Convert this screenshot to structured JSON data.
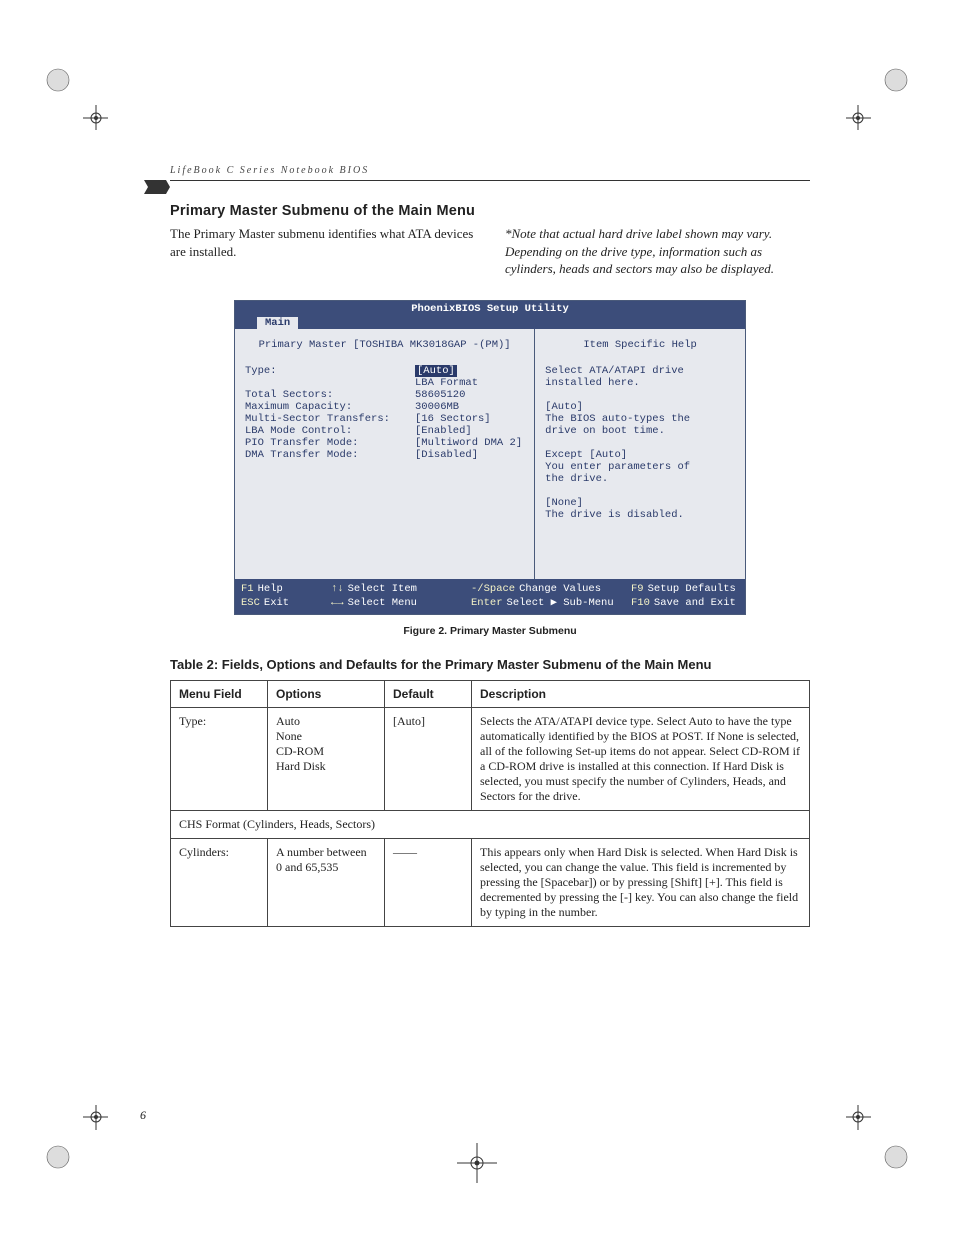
{
  "running_head": "LifeBook C Series Notebook BIOS",
  "section_title": "Primary Master Submenu of the Main Menu",
  "intro_left": "The Primary Master submenu identifies what ATA devices are installed.",
  "intro_right": "*Note that actual hard drive label shown may vary. Depending on the drive type, information such as cylinders, heads and sectors may also be displayed.",
  "bios": {
    "title": "PhoenixBIOS Setup Utility",
    "tab": "Main",
    "left_header": "Primary Master [TOSHIBA MK3018GAP -(PM)]",
    "right_header": "Item Specific Help",
    "fields": [
      {
        "label": "Type:",
        "value": "[Auto]",
        "hilite": true
      },
      {
        "label": "",
        "value": "LBA Format"
      },
      {
        "label": "Total Sectors:",
        "value": "58605120"
      },
      {
        "label": "Maximum Capacity:",
        "value": "30006MB"
      },
      {
        "label": "",
        "value": ""
      },
      {
        "label": "Multi-Sector Transfers:",
        "value": "[16 Sectors]"
      },
      {
        "label": "LBA Mode Control:",
        "value": "[Enabled]"
      },
      {
        "label": "PIO Transfer Mode:",
        "value": "[Multiword DMA 2]"
      },
      {
        "label": "DMA Transfer Mode:",
        "value": "[Disabled]"
      }
    ],
    "help": [
      "Select ATA/ATAPI drive",
      "installed here.",
      "",
      "[Auto]",
      "The BIOS auto-types the",
      "drive on boot time.",
      "",
      "Except [Auto]",
      "You enter parameters of",
      "the drive.",
      "",
      "[None]",
      "The drive is disabled."
    ],
    "footer": {
      "f1": "F1",
      "f1_label": "Help",
      "esc": "ESC",
      "esc_label": "Exit",
      "updown": "↑↓",
      "updown_label": "Select Item",
      "leftright": "←→",
      "leftright_label": "Select Menu",
      "minus": "-/Space",
      "minus_label": "Change Values",
      "enter": "Enter",
      "enter_label": "Select ▶ Sub-Menu",
      "f9": "F9",
      "f9_label": "Setup Defaults",
      "f10": "F10",
      "f10_label": "Save and Exit"
    }
  },
  "figure_caption": "Figure 2.  Primary Master Submenu",
  "table_title": "Table 2: Fields, Options and Defaults for the Primary Master Submenu of the Main Menu",
  "table": {
    "headers": [
      "Menu Field",
      "Options",
      "Default",
      "Description"
    ],
    "rows": [
      {
        "field": "Type:",
        "options": "Auto\nNone\nCD-ROM\nHard Disk",
        "default": "[Auto]",
        "desc": "Selects the ATA/ATAPI device type. Select Auto to have the type automatically identified by the BIOS at POST. If None is selected, all of the following Set-up items do not appear. Select CD-ROM if a CD-ROM drive is installed at this connection. If Hard Disk is selected, you must specify the number of Cylinders, Heads, and Sectors for the drive."
      }
    ],
    "span_row": "CHS Format (Cylinders, Heads, Sectors)",
    "rows2": [
      {
        "field": "Cylinders:",
        "options": "A number between\n0 and 65,535",
        "default": "——",
        "desc": "This appears only when Hard Disk is selected. When Hard Disk is selected, you can change the value. This field is incremented by pressing the [Spacebar]) or by pressing [Shift] [+]. This field is decremented by pressing the [-] key. You can also change the field by typing in the number."
      }
    ]
  },
  "page_number": "6"
}
